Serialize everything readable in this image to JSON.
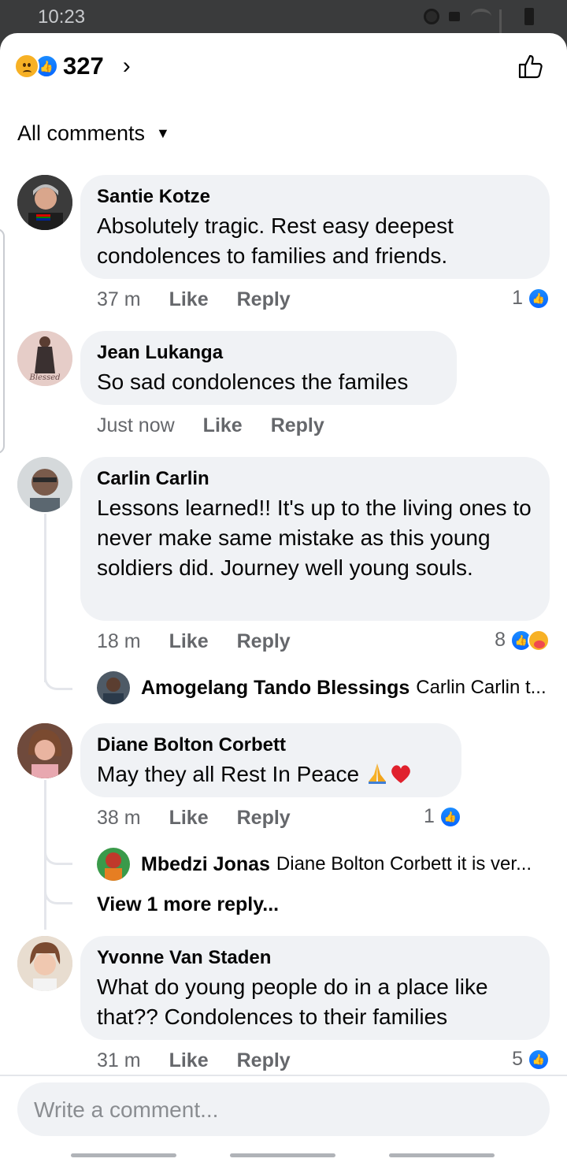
{
  "status_bar": {
    "time": "10:23"
  },
  "reactions": {
    "count": "327"
  },
  "sort": {
    "label": "All comments"
  },
  "comments": [
    {
      "author": "Santie Kotze",
      "text": "Absolutely tragic. Rest easy deepest condolences to families and friends.",
      "time": "37 m",
      "like_label": "Like",
      "reply_label": "Reply",
      "reaction_count": "1"
    },
    {
      "author": "Jean Lukanga",
      "text": "So sad condolences the familes",
      "time": "Just now",
      "like_label": "Like",
      "reply_label": "Reply"
    },
    {
      "author": "Carlin Carlin",
      "text": "Lessons learned!! It's up to the living ones to never make same mistake as this young soldiers did. Journey well young souls.",
      "time": "18 m",
      "like_label": "Like",
      "reply_label": "Reply",
      "reaction_count": "8",
      "reply_preview": {
        "name": "Amogelang Tando Blessings",
        "text": "Carlin Carlin t..."
      }
    },
    {
      "author": "Diane Bolton Corbett",
      "text": "May they all Rest In Peace",
      "time": "38 m",
      "like_label": "Like",
      "reply_label": "Reply",
      "reaction_count": "1",
      "reply_preview": {
        "name": "Mbedzi Jonas",
        "text": "Diane Bolton Corbett it is ver..."
      },
      "view_more": "View 1 more reply..."
    },
    {
      "author": "Yvonne Van Staden",
      "text": "What do young people do in a place like that?? Condolences to their families",
      "time": "31 m",
      "like_label": "Like",
      "reply_label": "Reply",
      "reaction_count": "5"
    }
  ],
  "avatar_labels": {
    "jean_badge": "Blessed"
  },
  "composer": {
    "placeholder": "Write a comment..."
  },
  "colors": {
    "like_blue": "#0866ff",
    "bubble_bg": "#f0f2f5",
    "meta_gray": "#65676b"
  }
}
